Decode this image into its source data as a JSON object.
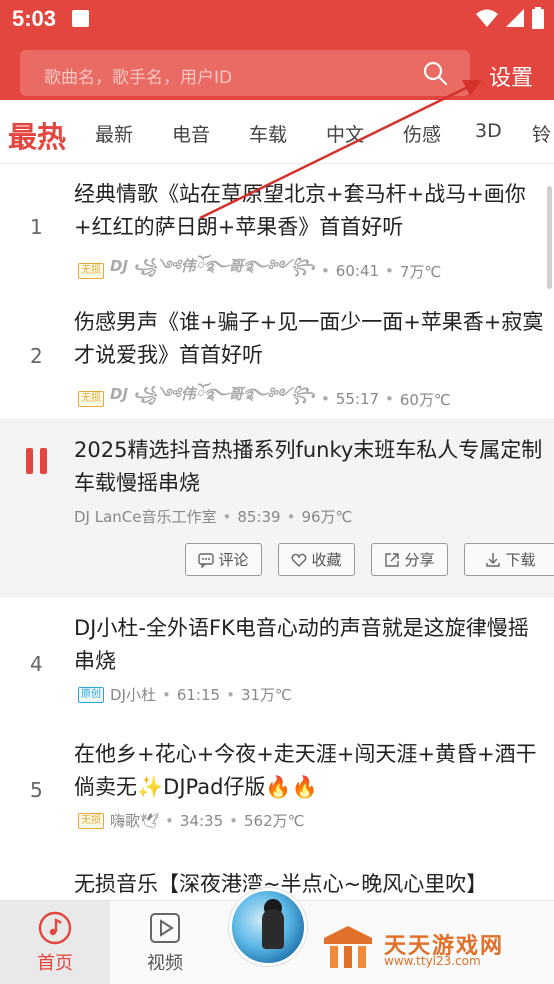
{
  "status": {
    "time": "5:03"
  },
  "search": {
    "placeholder": "歌曲名，歌手名，用户ID"
  },
  "header": {
    "settings_label": "设置"
  },
  "tabs": [
    "最热",
    "最新",
    "电音",
    "车载",
    "中文",
    "伤感",
    "3D",
    "铃"
  ],
  "songs": [
    {
      "num": "1",
      "title": "经典情歌《站在草原望北京+套马杆+战马+画你+红红的萨日朗+苹果香》首首好听",
      "badge": "无损",
      "author": "DJ ꧁༺伟ོ࿐哥࿐༻꧂",
      "duration": "60:41",
      "plays": "7万℃"
    },
    {
      "num": "2",
      "title": "伤感男声《谁+骗子+见一面少一面+苹果香+寂寞才说爱我》首首好听",
      "badge": "无损",
      "author": "DJ ꧁༺伟ོ࿐哥࿐༻꧂",
      "duration": "55:17",
      "plays": "60万℃"
    },
    {
      "num": "",
      "title": "2025精选抖音热播系列funky末班车私人专属定制车载慢摇串烧",
      "badge": "",
      "author": "DJ LanCe音乐工作室",
      "duration": "85:39",
      "plays": "96万℃"
    },
    {
      "num": "4",
      "title": "DJ小杜-全外语FK电音心动的声音就是这旋律慢摇串烧",
      "badge": "原创",
      "author": "DJ小杜",
      "duration": "61:15",
      "plays": "31万℃"
    },
    {
      "num": "5",
      "title": "在他乡+花心+今夜+走天涯+闯天涯+黄昏+酒干倘卖无✨DJPad仔版🔥🔥",
      "badge": "无损",
      "author": "嗨歌🕊",
      "duration": "34:35",
      "plays": "562万℃"
    },
    {
      "num": "",
      "title": "无损音乐【深夜港湾~半点心~晚风心里吹】",
      "badge": "",
      "author": "",
      "duration": "",
      "plays": ""
    }
  ],
  "actions": {
    "comment": "评论",
    "favorite": "收藏",
    "share": "分享",
    "download": "下载"
  },
  "nav": {
    "home": "首页",
    "video": "视频"
  },
  "watermark": {
    "title": "天天游戏网",
    "url": "www.ttyl23.com"
  },
  "colors": {
    "brand_red": "#e2463f",
    "badge_lossless": "#e8a63a",
    "badge_original": "#2aa6d8"
  }
}
